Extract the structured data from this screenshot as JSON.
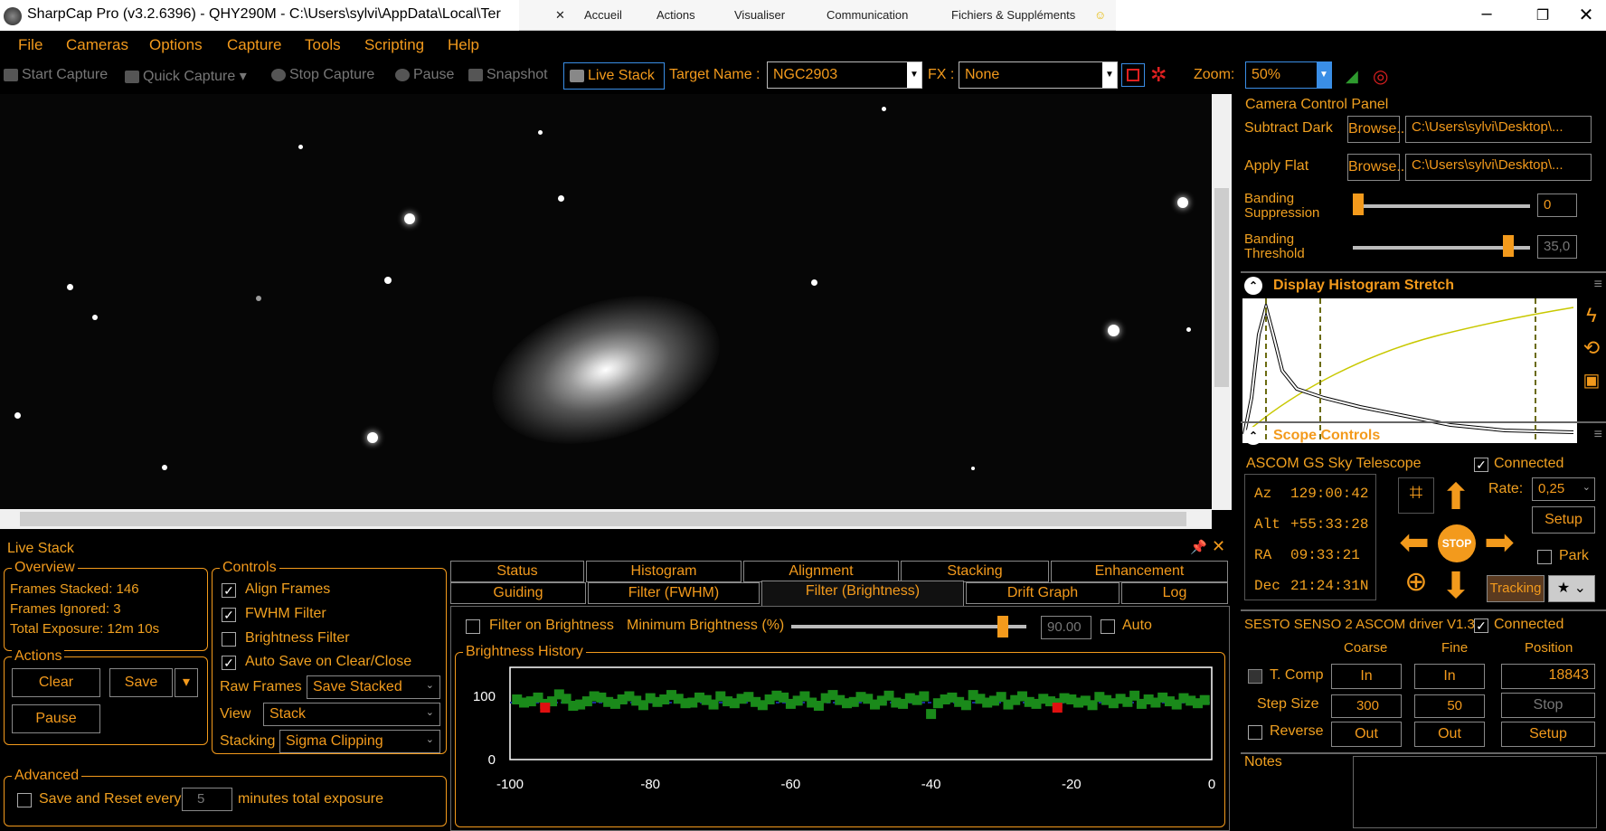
{
  "window": {
    "title": "SharpCap Pro (v3.2.6396) - QHY290M - C:\\Users\\sylvi\\AppData\\Local\\Ter",
    "extension_bar": [
      "Accueil",
      "Actions",
      "Visualiser",
      "Communication",
      "Fichiers & Suppléments"
    ]
  },
  "menu": [
    "File",
    "Cameras",
    "Options",
    "Capture",
    "Tools",
    "Scripting",
    "Help"
  ],
  "toolbar": {
    "start_capture": "Start Capture",
    "quick_capture": "Quick Capture",
    "stop_capture": "Stop Capture",
    "pause": "Pause",
    "snapshot": "Snapshot",
    "live_stack": "Live Stack",
    "target_label": "Target Name :",
    "target_value": "NGC2903",
    "fx_label": "FX :",
    "fx_value": "None",
    "zoom_label": "Zoom:",
    "zoom_value": "50%"
  },
  "camera_panel": {
    "title": "Camera Control Panel",
    "subtract_dark": "Subtract Dark",
    "apply_flat": "Apply Flat",
    "browse": "Browse...",
    "dark_path": "C:\\Users\\sylvi\\Desktop\\...",
    "flat_path": "C:\\Users\\sylvi\\Desktop\\...",
    "banding_suppression": "Banding\nSuppression",
    "banding_suppression_value": "0",
    "banding_suppression_level": 0.0,
    "banding_threshold": "Banding\nThreshold",
    "banding_threshold_value": "35,0",
    "banding_threshold_level": 0.88
  },
  "histogram": {
    "title": "Display Histogram Stretch"
  },
  "scope": {
    "title": "Scope Controls",
    "mount": "ASCOM GS Sky Telescope",
    "connected": "Connected",
    "az_label": "Az",
    "az": "129:00:42",
    "alt_label": "Alt",
    "alt": "+55:33:28",
    "ra_label": "RA",
    "ra": "09:33:21",
    "dec_label": "Dec",
    "dec": "21:24:31N",
    "rate_label": "Rate:",
    "rate": "0,25",
    "setup": "Setup",
    "park": "Park",
    "stop": "STOP",
    "tracking": "Tracking"
  },
  "focuser": {
    "name": "SESTO SENSO 2 ASCOM driver V1.3",
    "connected": "Connected",
    "coarse": "Coarse",
    "fine": "Fine",
    "position": "Position",
    "tcomp": "T. Comp",
    "in": "In",
    "out": "Out",
    "position_value": "18843",
    "step_size": "Step Size",
    "coarse_step": "300",
    "fine_step": "50",
    "stop": "Stop",
    "setup": "Setup",
    "reverse": "Reverse",
    "notes": "Notes"
  },
  "livestack": {
    "title": "Live Stack",
    "overview": "Overview",
    "frames_stacked": "Frames Stacked:  146",
    "frames_ignored": "Frames Ignored:  3",
    "total_exposure": "Total Exposure:   12m 10s",
    "actions": "Actions",
    "clear": "Clear",
    "save": "Save",
    "pause": "Pause",
    "controls": "Controls",
    "align_frames": "Align Frames",
    "fwhm_filter": "FWHM Filter",
    "brightness_filter": "Brightness Filter",
    "auto_save": "Auto Save on Clear/Close",
    "raw_frames_label": "Raw Frames",
    "raw_frames": "Save Stacked",
    "view_label": "View",
    "view": "Stack",
    "stacking_label": "Stacking",
    "stacking": "Sigma Clipping",
    "advanced": "Advanced",
    "save_reset": "Save and Reset every",
    "save_reset_value": "5",
    "minutes_total": "minutes total exposure",
    "tabs_top": [
      "Status",
      "Histogram",
      "Alignment",
      "Stacking",
      "Enhancement"
    ],
    "tabs_bottom": [
      "Guiding",
      "Filter (FWHM)",
      "Filter (Brightness)",
      "Drift Graph",
      "Log"
    ],
    "filter_on_brightness": "Filter on Brightness",
    "min_brightness_label": "Minimum Brightness (%)",
    "min_brightness": "90.00",
    "min_brightness_level": 0.9,
    "auto": "Auto",
    "history_title": "Brightness History"
  },
  "chart_data": {
    "type": "scatter",
    "title": "Brightness History",
    "xlim": [
      -100,
      0
    ],
    "ylim": [
      0,
      100
    ],
    "x_ticks": [
      "-100",
      "-80",
      "-60",
      "-40",
      "-20",
      "0"
    ],
    "y_ticks": [
      "100",
      "0"
    ],
    "threshold": 90,
    "series": [
      {
        "color": "#1a8a1a",
        "x": [
          -99,
          -98,
          -97,
          -96,
          -95,
          -94,
          -93,
          -92,
          -91,
          -90,
          -89,
          -88,
          -87,
          -86,
          -85,
          -84,
          -83,
          -82,
          -81,
          -80,
          -79,
          -78,
          -77,
          -76,
          -75,
          -74,
          -73,
          -72,
          -71,
          -70,
          -69,
          -68,
          -67,
          -66,
          -65,
          -64,
          -63,
          -62,
          -61,
          -60,
          -59,
          -58,
          -57,
          -56,
          -55,
          -54,
          -53,
          -52,
          -51,
          -50,
          -49,
          -48,
          -47,
          -46,
          -45,
          -44,
          -43,
          -42,
          -41,
          -40,
          -39,
          -38,
          -37,
          -36,
          -35,
          -34,
          -33,
          -32,
          -31,
          -30,
          -29,
          -28,
          -27,
          -26,
          -25,
          -24,
          -23,
          -22,
          -21,
          -20,
          -19,
          -18,
          -17,
          -16,
          -15,
          -14,
          -13,
          -12,
          -11,
          -10,
          -9,
          -8,
          -7,
          -6,
          -5,
          -4,
          -3,
          -2,
          -1
        ],
        "y": [
          95,
          90,
          92,
          98,
          88,
          92,
          103,
          96,
          85,
          87,
          92,
          100,
          98,
          91,
          88,
          95,
          100,
          93,
          86,
          97,
          91,
          95,
          102,
          96,
          89,
          90,
          98,
          94,
          87,
          100,
          92,
          89,
          96,
          99,
          91,
          86,
          95,
          101,
          98,
          88,
          93,
          100,
          90,
          85,
          97,
          102,
          94,
          89,
          91,
          99,
          96,
          87,
          93,
          101,
          90,
          88,
          97,
          94,
          100,
          72,
          89,
          95,
          98,
          91,
          86,
          102,
          96,
          90,
          93,
          99,
          87,
          94,
          100,
          91,
          88,
          96,
          92,
          89,
          97,
          95,
          90,
          93,
          86,
          99,
          94,
          89,
          96,
          91,
          101,
          88,
          95,
          90,
          98,
          92,
          87,
          97,
          93,
          89,
          94
        ]
      },
      {
        "color": "#e01010",
        "x": [
          -95,
          -22
        ],
        "y": [
          82,
          82
        ]
      }
    ]
  }
}
